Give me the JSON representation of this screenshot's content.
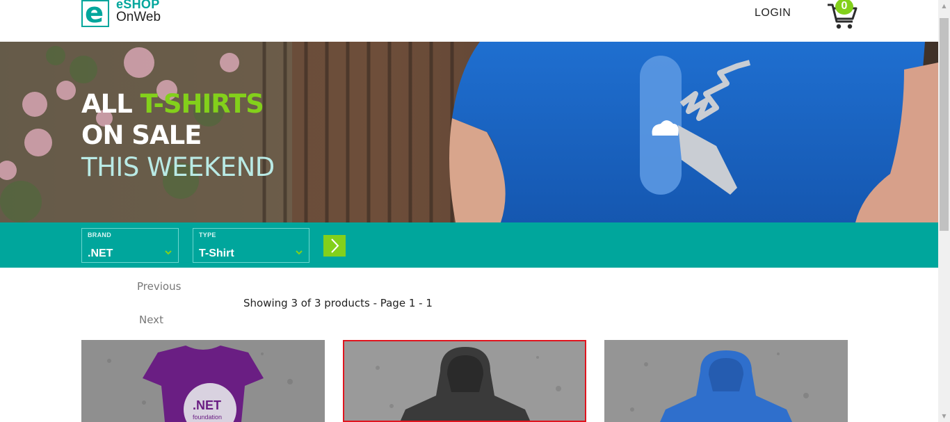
{
  "header": {
    "logo": {
      "mark": "e",
      "line1": "eSHOP",
      "line2": "OnWeb"
    },
    "login_label": "LOGIN",
    "cart": {
      "icon": "cart-icon",
      "count": "0"
    }
  },
  "hero": {
    "line1_prefix": "ALL ",
    "line1_accent": "T-SHIRTS",
    "line2": "ON SALE",
    "line3": "THIS WEEKEND"
  },
  "filters": {
    "brand": {
      "label": "BRAND",
      "value": ".NET"
    },
    "type": {
      "label": "TYPE",
      "value": "T-Shirt"
    },
    "apply_icon": "chevron-right-icon"
  },
  "pager": {
    "previous_label": "Previous",
    "next_label": "Next",
    "summary": "Showing 3 of 3 products - Page 1 - 1"
  },
  "products": [
    {
      "image": "purple .NET foundation t-shirt",
      "selected": false
    },
    {
      "image": "black hoodie",
      "selected": true
    },
    {
      "image": "blue hoodie",
      "selected": false
    }
  ],
  "colors": {
    "teal": "#00a69c",
    "green": "#83d01b",
    "selected_border": "#e0141e"
  }
}
